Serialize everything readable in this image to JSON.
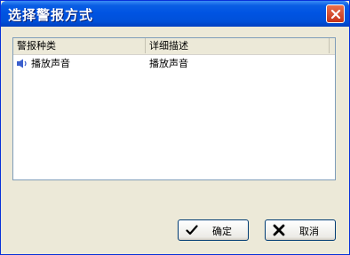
{
  "window": {
    "title": "选择警报方式"
  },
  "list": {
    "columns": [
      "警报种类",
      "详细描述"
    ],
    "rows": [
      {
        "icon": "speaker-icon",
        "type": "播放声音",
        "description": "播放声音"
      }
    ]
  },
  "buttons": {
    "ok_label": "确定",
    "cancel_label": "取消"
  },
  "colors": {
    "titlebar": "#0054e3",
    "face": "#ece9d8",
    "accent_border": "#003c74"
  }
}
